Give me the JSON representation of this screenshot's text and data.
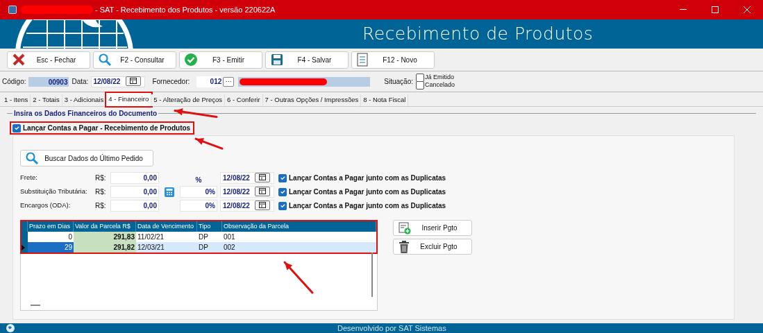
{
  "window": {
    "title": "- SAT - Recebimento dos Produtos - versão 220622A"
  },
  "header": {
    "title": "Recebimento de Produtos"
  },
  "toolbar": [
    {
      "label": "Esc - Fechar",
      "kind": "close"
    },
    {
      "label": "F2 - Consultar",
      "kind": "search"
    },
    {
      "label": "F3 - Emitir",
      "kind": "emit"
    },
    {
      "label": "F4 - Salvar",
      "kind": "save"
    },
    {
      "label": "F12 - Novo",
      "kind": "new"
    }
  ],
  "form": {
    "codigo_label": "Código:",
    "codigo": "00903",
    "data_label": "Data:",
    "data": "12/08/22",
    "fornecedor_label": "Fornecedor:",
    "fornecedor": "012",
    "fornecedor_button": "···",
    "situacao_label": "Situação:",
    "situacao": [
      {
        "label": "Já Emitido",
        "checked": false
      },
      {
        "label": "Cancelado",
        "checked": false
      }
    ]
  },
  "tabs": [
    {
      "label": "1 - Itens",
      "selected": false
    },
    {
      "label": "2 - Totais",
      "selected": false
    },
    {
      "label": "3 - Adicionais",
      "selected": false
    },
    {
      "label": "4 - Financeiro",
      "selected": true
    },
    {
      "label": "5 - Alteração de Preços",
      "selected": false
    },
    {
      "label": "6 - Conferir",
      "selected": false
    },
    {
      "label": "7 - Outras Opções / Impressões",
      "selected": false
    },
    {
      "label": "8 - Nota Fiscal",
      "selected": false
    }
  ],
  "section": {
    "title": "Insira os Dados Financeiros do Documento",
    "main_check": {
      "label": "Lançar Contas a Pagar - Recebimento de Produtos",
      "checked": true
    },
    "fetch_button": "Buscar Dados do Último Pedido",
    "percent_header": "%",
    "charges": [
      {
        "label": "Frete:",
        "currency": "R$:",
        "value": "0,00",
        "date": "12/08/22",
        "check": {
          "label": "Lançar Contas a Pagar junto com as Duplicatas",
          "checked": true
        }
      },
      {
        "label": "Substituição Tributária:",
        "currency": "R$:",
        "value": "0,00",
        "percent": "0%",
        "date": "12/08/22",
        "check": {
          "label": "Lançar Contas a Pagar junto com as Duplicatas",
          "checked": true
        }
      },
      {
        "label": "Encargos (ODA):",
        "currency": "R$:",
        "value": "0,00",
        "percent": "0%",
        "date": "12/08/22",
        "check": {
          "label": "Lançar Contas a Pagar junto com as Duplicatas",
          "checked": true
        }
      }
    ]
  },
  "table": {
    "columns": [
      "Prazo em Dias",
      "Valor da Parcela R$",
      "Data de Vencimento",
      "Tipo",
      "Observação da Parcela"
    ],
    "rows": [
      {
        "selected": false,
        "cells": [
          "0",
          "291,83",
          "11/02/21",
          "DP",
          "001"
        ]
      },
      {
        "selected": true,
        "cells": [
          "29",
          "291,82",
          "12/03/21",
          "DP",
          "002"
        ]
      }
    ]
  },
  "side_buttons": [
    {
      "label": "Inserir Pgto",
      "kind": "insert"
    },
    {
      "label": "Excluir Pgto",
      "kind": "delete"
    }
  ],
  "status_bar": {
    "text": "Desenvolvido por SAT Sistemas"
  }
}
